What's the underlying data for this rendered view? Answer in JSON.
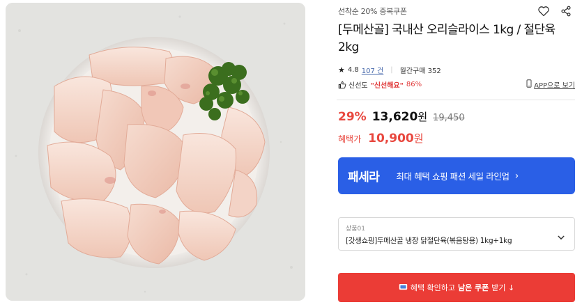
{
  "product": {
    "coupon_tag": "선착순 20% 중복쿠폰",
    "title": "[두메산골] 국내산 오리슬라이스 1kg / 절단육 2kg",
    "rating": "4.8",
    "review_count": "107 건",
    "monthly_sales": "월간구매 352",
    "freshness_label": "신선도",
    "freshness_quote": "\"신선해요\"",
    "freshness_pct": "86%",
    "app_link": "APP으로 보기",
    "discount_rate": "29%",
    "sale_price": "13,620",
    "currency": "원",
    "original_price": "19,450",
    "benefit_label": "혜택가",
    "benefit_price": "10,900"
  },
  "banner": {
    "brand": "패세라",
    "text": "최대 혜택 쇼핑 패션 세일 라인업",
    "chevron": "›"
  },
  "option": {
    "label": "상품01",
    "value": "[갓생쇼핑]두메산골 냉장 닭절단육(볶음탕용) 1kg+1kg"
  },
  "cta": {
    "text_pre": "혜택 확인하고",
    "text_bold": "남은 쿠폰",
    "text_post": "받기 ↓"
  },
  "icons": [
    "heart-icon",
    "share-icon",
    "star-icon",
    "thumbs-up-icon",
    "mobile-icon",
    "chevron-down-icon",
    "coupon-icon"
  ],
  "colors": {
    "accent_red": "#e8473e",
    "banner_blue": "#2a5fe6",
    "cta_red": "#eb3c36"
  }
}
